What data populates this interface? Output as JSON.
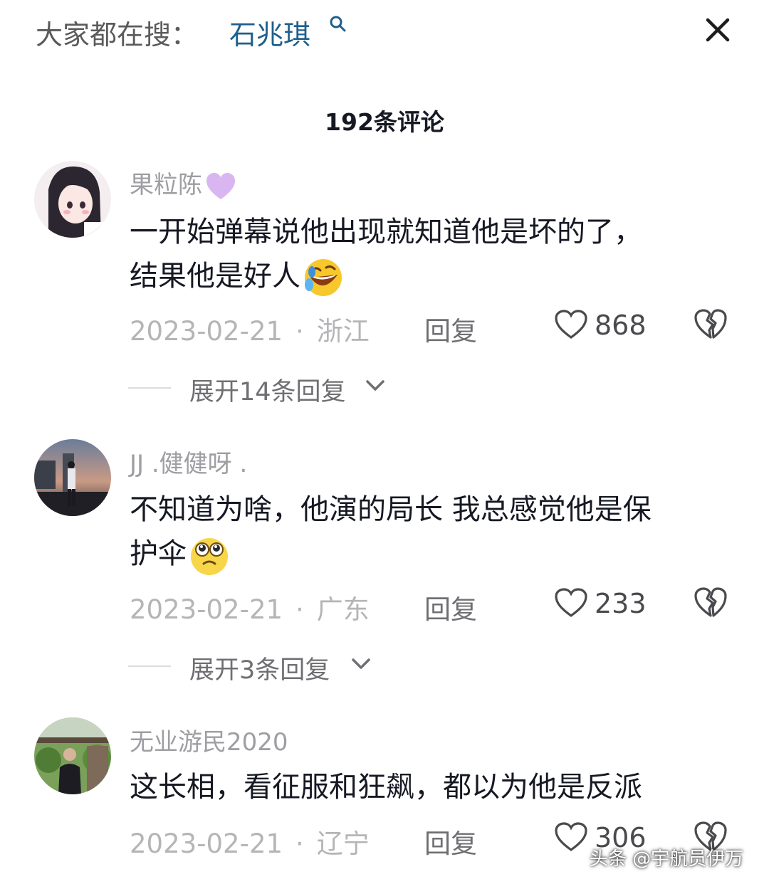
{
  "header": {
    "search_prefix": "大家都在搜：",
    "search_term": "石兆琪",
    "search_icon": "search-icon",
    "close_icon": "close-icon"
  },
  "comments_title": "192条评论",
  "comments": [
    {
      "username": "果粒陈",
      "username_emoji": "purple-heart-emoji",
      "line1": "一开始弹幕说他出现就知道他是坏的了，",
      "line2": "结果他是好人",
      "emoji": "rolling-laughing-emoji",
      "date": "2023-02-21",
      "separator": "·",
      "location": "浙江",
      "reply": "回复",
      "likes": "868",
      "expand": "展开14条回复"
    },
    {
      "username": "JJ .健健呀 .",
      "line1": "不知道为啥，他演的局长 我总感觉他是保",
      "line2": "护伞",
      "emoji": "teary-eyed-emoji",
      "date": "2023-02-21",
      "separator": "·",
      "location": "广东",
      "reply": "回复",
      "likes": "233",
      "expand": "展开3条回复"
    },
    {
      "username": "无业游民2020",
      "line1": "这长相，看征服和狂飙，都以为他是反派",
      "date": "2023-02-21",
      "separator": "·",
      "location": "辽宁",
      "reply": "回复",
      "likes": "306"
    }
  ],
  "watermark": "头条 @宇航员伊万",
  "colors": {
    "search_term": "#1f5f8b",
    "meta_gray": "#b5b5b8",
    "username_gray": "#9e9ea3",
    "text": "#161823"
  }
}
